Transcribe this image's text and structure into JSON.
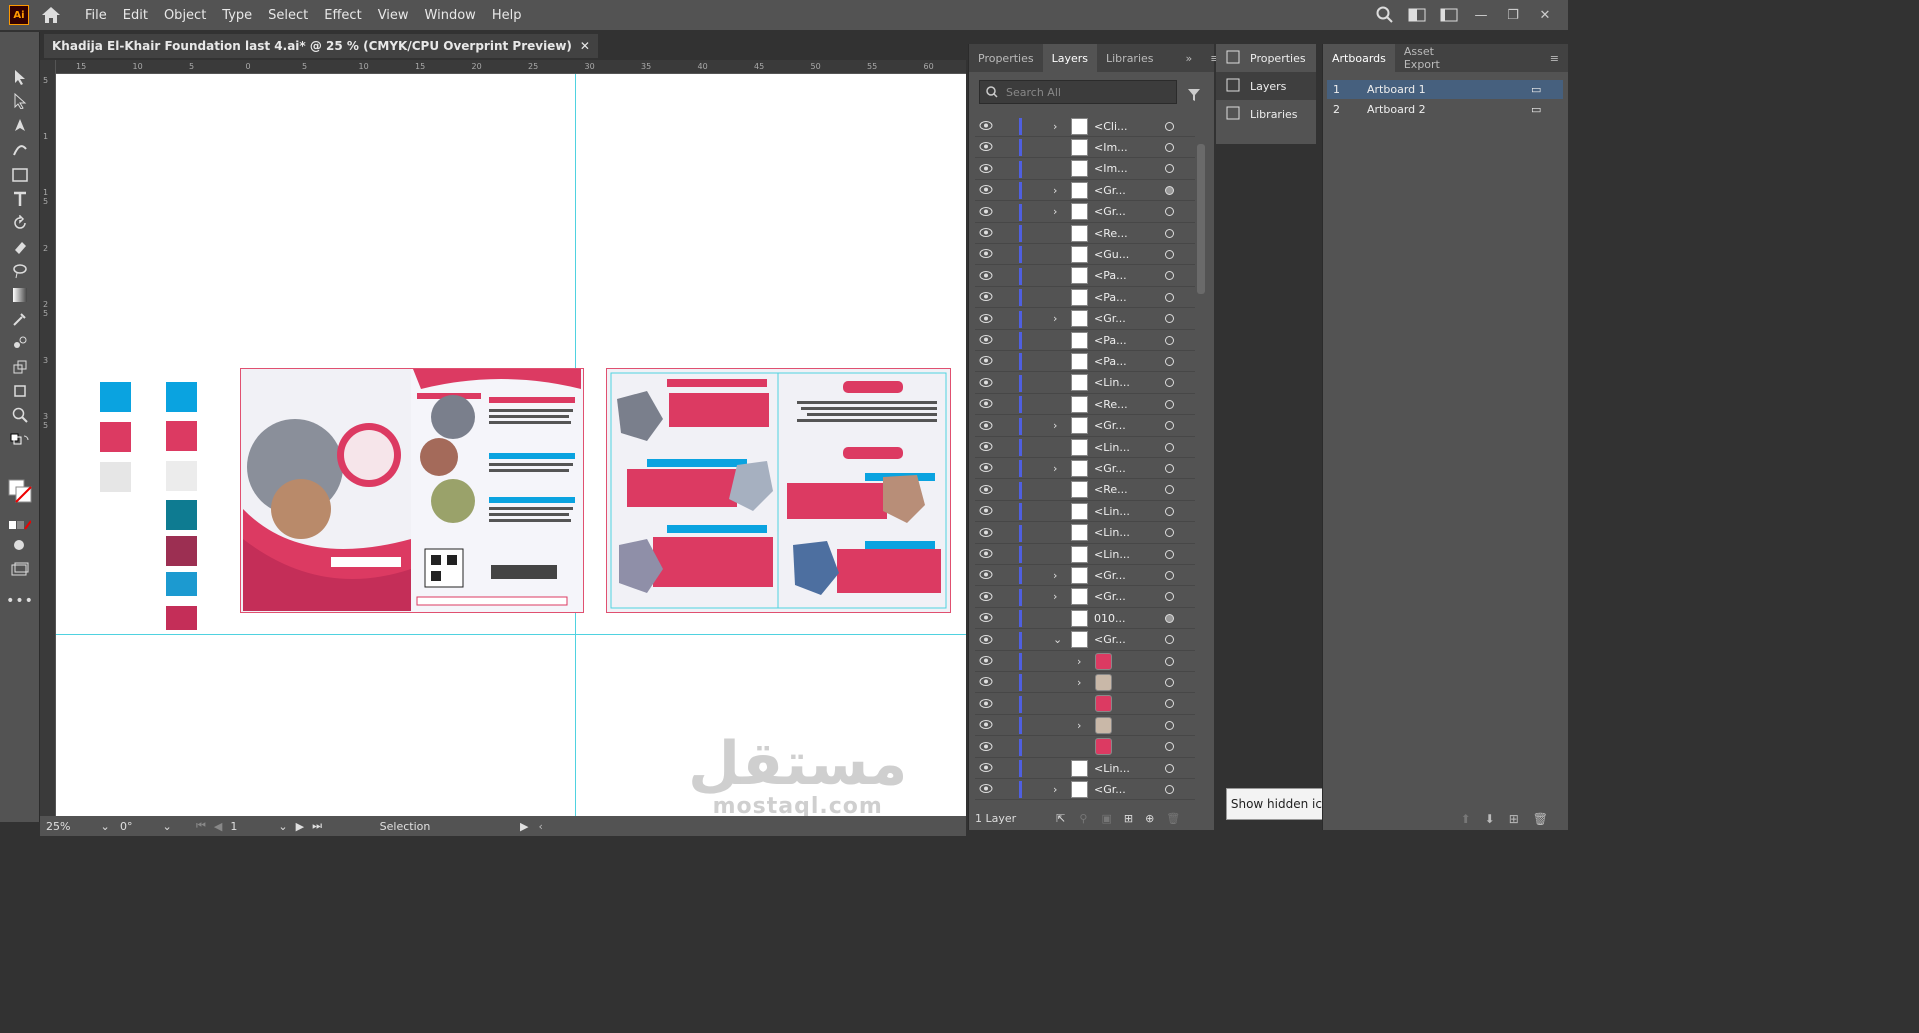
{
  "app": {
    "logo": "Ai"
  },
  "menu": [
    "File",
    "Edit",
    "Object",
    "Type",
    "Select",
    "Effect",
    "View",
    "Window",
    "Help"
  ],
  "document_tab": {
    "title": "Khadija El-Khair Foundation last 4.ai* @ 25 % (CMYK/CPU Overprint Preview)",
    "close": "✕"
  },
  "ruler_h_ticks": [
    "15",
    "10",
    "5",
    "0",
    "5",
    "10",
    "15",
    "20",
    "25",
    "30",
    "35",
    "40",
    "45",
    "50",
    "55",
    "60"
  ],
  "ruler_v_ticks": [
    "5",
    "1",
    "1 5",
    "2",
    "2 5",
    "3",
    "3 5"
  ],
  "swatch_colors": {
    "left": [
      "#0aa3e0",
      "#dc3a62",
      "#e6e6e6"
    ],
    "right": [
      "#0aa3e0",
      "#dc3a62",
      "#ececec",
      "#0e7b91",
      "#9c2f52",
      "#1c9ad0",
      "#c42e58"
    ]
  },
  "status": {
    "zoom": "25%",
    "rotation": "0°",
    "artboard_num": "1",
    "tool": "Selection"
  },
  "layers_panel": {
    "tabs": [
      "Properties",
      "Layers",
      "Libraries"
    ],
    "search_placeholder": "Search All",
    "rows": [
      {
        "name": "<Cli...",
        "expand": true,
        "target": false
      },
      {
        "name": "<Im...",
        "expand": false,
        "target": false
      },
      {
        "name": "<Im...",
        "expand": false,
        "target": false
      },
      {
        "name": "<Gr...",
        "expand": true,
        "target": true
      },
      {
        "name": "<Gr...",
        "expand": true,
        "target": false
      },
      {
        "name": "<Re...",
        "expand": false,
        "target": false
      },
      {
        "name": "<Gu...",
        "expand": false,
        "target": false
      },
      {
        "name": "<Pa...",
        "expand": false,
        "target": false
      },
      {
        "name": "<Pa...",
        "expand": false,
        "target": false
      },
      {
        "name": "<Gr...",
        "expand": true,
        "target": false
      },
      {
        "name": "<Pa...",
        "expand": false,
        "target": false
      },
      {
        "name": "<Pa...",
        "expand": false,
        "target": false
      },
      {
        "name": "<Lin...",
        "expand": false,
        "target": false
      },
      {
        "name": "<Re...",
        "expand": false,
        "target": false
      },
      {
        "name": "<Gr...",
        "expand": true,
        "target": false
      },
      {
        "name": "<Lin...",
        "expand": false,
        "target": false
      },
      {
        "name": "<Gr...",
        "expand": true,
        "target": false
      },
      {
        "name": "<Re...",
        "expand": false,
        "target": false
      },
      {
        "name": "<Lin...",
        "expand": false,
        "target": false
      },
      {
        "name": "<Lin...",
        "expand": false,
        "target": false
      },
      {
        "name": "<Lin...",
        "expand": false,
        "target": false
      },
      {
        "name": "<Gr...",
        "expand": true,
        "target": false
      },
      {
        "name": "<Gr...",
        "expand": true,
        "target": false
      },
      {
        "name": "010...",
        "expand": false,
        "target": true
      },
      {
        "name": "<Gr...",
        "expand": "open",
        "target": false
      },
      {
        "name": "",
        "expand": true,
        "target": false,
        "sub": true
      },
      {
        "name": "",
        "expand": true,
        "target": false,
        "sub": true
      },
      {
        "name": "",
        "expand": false,
        "target": false,
        "sub": true
      },
      {
        "name": "",
        "expand": true,
        "target": false,
        "sub": true
      },
      {
        "name": "",
        "expand": false,
        "target": false,
        "sub": true
      },
      {
        "name": "<Lin...",
        "expand": false,
        "target": false
      },
      {
        "name": "<Gr...",
        "expand": true,
        "target": false
      }
    ],
    "footer": "1 Layer"
  },
  "props_panel": {
    "items": [
      "Properties",
      "Layers",
      "Libraries"
    ]
  },
  "tooltip": "Show hidden icons",
  "artboards_panel": {
    "tabs": [
      "Artboards",
      "Asset Export"
    ],
    "rows": [
      {
        "num": "1",
        "name": "Artboard 1"
      },
      {
        "num": "2",
        "name": "Artboard 2"
      }
    ]
  },
  "watermark": {
    "arabic": "مستقل",
    "latin": "mostaql.com"
  }
}
